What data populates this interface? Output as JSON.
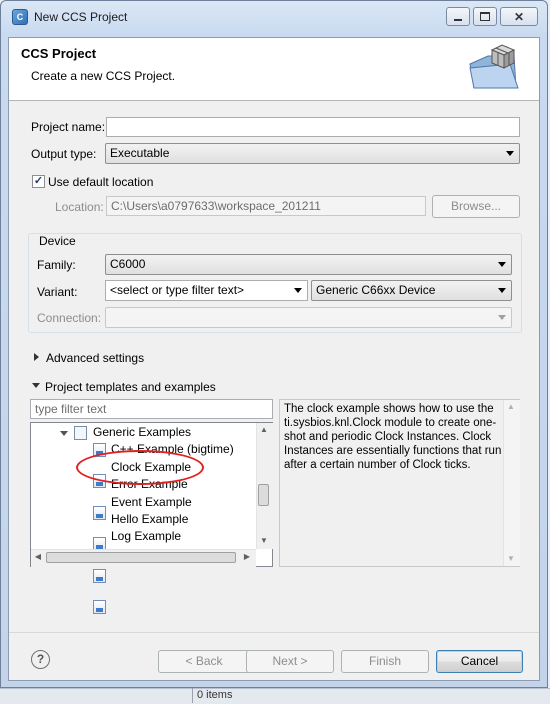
{
  "window": {
    "title": "New CCS Project",
    "app_icon": "ccs-app-icon",
    "controls": [
      "minimize-icon",
      "maximize-icon",
      "close-icon"
    ]
  },
  "header": {
    "title": "CCS Project",
    "subtitle": "Create a new CCS Project.",
    "banner_icon": "folder-cube-icon"
  },
  "form": {
    "project_name_label": "Project name:",
    "project_name_value": "",
    "output_type_label": "Output type:",
    "output_type_value": "Executable",
    "use_default_location_label": "Use default location",
    "use_default_location_checked": true,
    "location_label": "Location:",
    "location_value": "C:\\Users\\a0797633\\workspace_201211",
    "browse_label": "Browse..."
  },
  "device": {
    "group_label": "Device",
    "family_label": "Family:",
    "family_value": "C6000",
    "variant_label": "Variant:",
    "variant_filter_value": "<select or type filter text>",
    "variant_value": "Generic C66xx Device",
    "connection_label": "Connection:",
    "connection_value": ""
  },
  "sections": {
    "advanced_label": "Advanced settings",
    "templates_label": "Project templates and examples"
  },
  "templates": {
    "filter_placeholder": "type filter text",
    "tree": [
      {
        "label": "Generic Examples",
        "type": "folder",
        "expanded": true
      },
      {
        "label": "C++ Example (bigtime)",
        "type": "example"
      },
      {
        "label": "Clock Example",
        "type": "example",
        "highlighted": true
      },
      {
        "label": "Error Example",
        "type": "example"
      },
      {
        "label": "Event Example",
        "type": "example"
      },
      {
        "label": "Hello Example",
        "type": "example"
      },
      {
        "label": "Log Example",
        "type": "example"
      }
    ],
    "description": "The clock example shows how to use the ti.sysbios.knl.Clock module to create one-shot and periodic Clock Instances. Clock Instances are essentially functions that run after a certain number of Clock ticks."
  },
  "footer": {
    "back_label": "< Back",
    "next_label": "Next >",
    "finish_label": "Finish",
    "cancel_label": "Cancel"
  },
  "background": {
    "status_text": "0 items"
  },
  "colors": {
    "highlight_ellipse": "#e02020",
    "title_bar": "#c9daf0"
  }
}
